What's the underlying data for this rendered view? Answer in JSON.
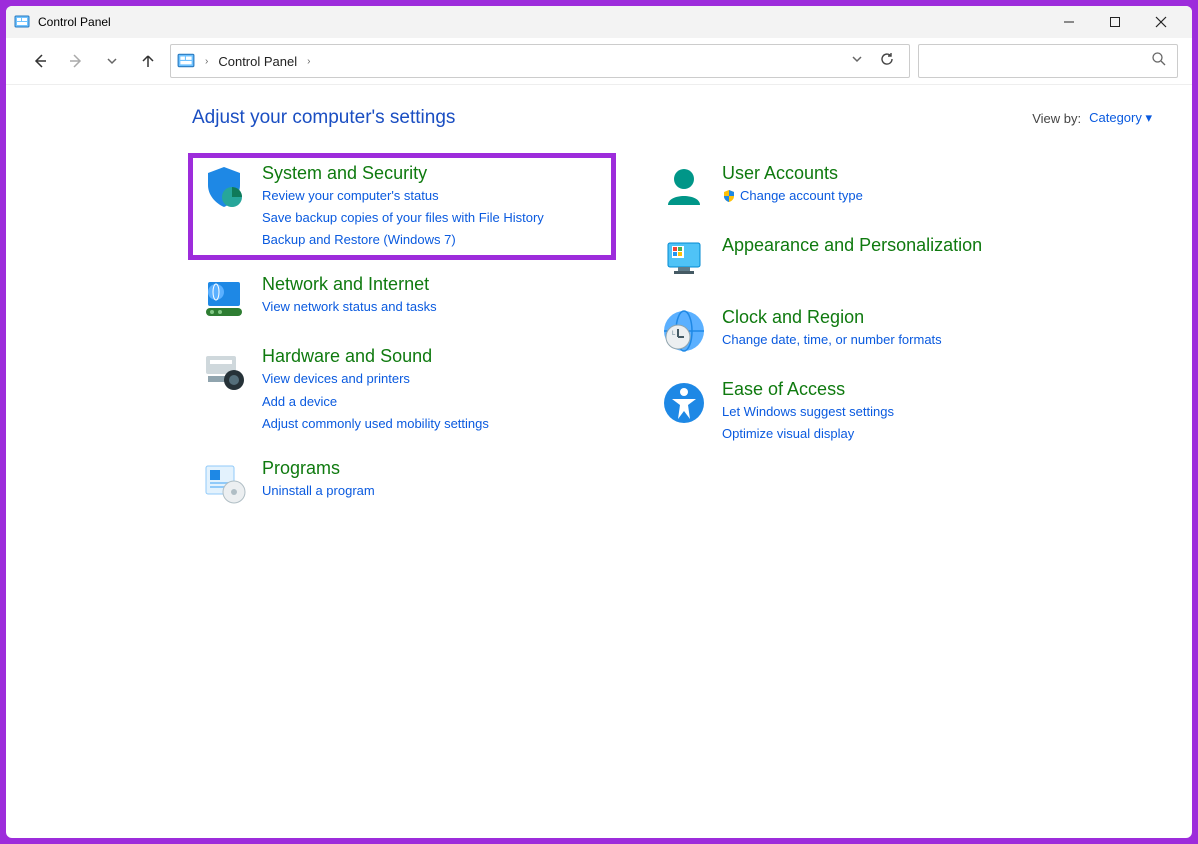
{
  "window": {
    "title": "Control Panel"
  },
  "breadcrumb": {
    "root": "Control Panel"
  },
  "header": {
    "heading": "Adjust your computer's settings",
    "viewby_label": "View by:",
    "viewby_value": "Category"
  },
  "left": [
    {
      "title": "System and Security",
      "links": [
        "Review your computer's status",
        "Save backup copies of your files with File History",
        "Backup and Restore (Windows 7)"
      ],
      "highlight": true
    },
    {
      "title": "Network and Internet",
      "links": [
        "View network status and tasks"
      ]
    },
    {
      "title": "Hardware and Sound",
      "links": [
        "View devices and printers",
        "Add a device",
        "Adjust commonly used mobility settings"
      ]
    },
    {
      "title": "Programs",
      "links": [
        "Uninstall a program"
      ]
    }
  ],
  "right": [
    {
      "title": "User Accounts",
      "links": [
        "Change account type"
      ],
      "shield": [
        true
      ]
    },
    {
      "title": "Appearance and Personalization",
      "links": []
    },
    {
      "title": "Clock and Region",
      "links": [
        "Change date, time, or number formats"
      ]
    },
    {
      "title": "Ease of Access",
      "links": [
        "Let Windows suggest settings",
        "Optimize visual display"
      ]
    }
  ]
}
